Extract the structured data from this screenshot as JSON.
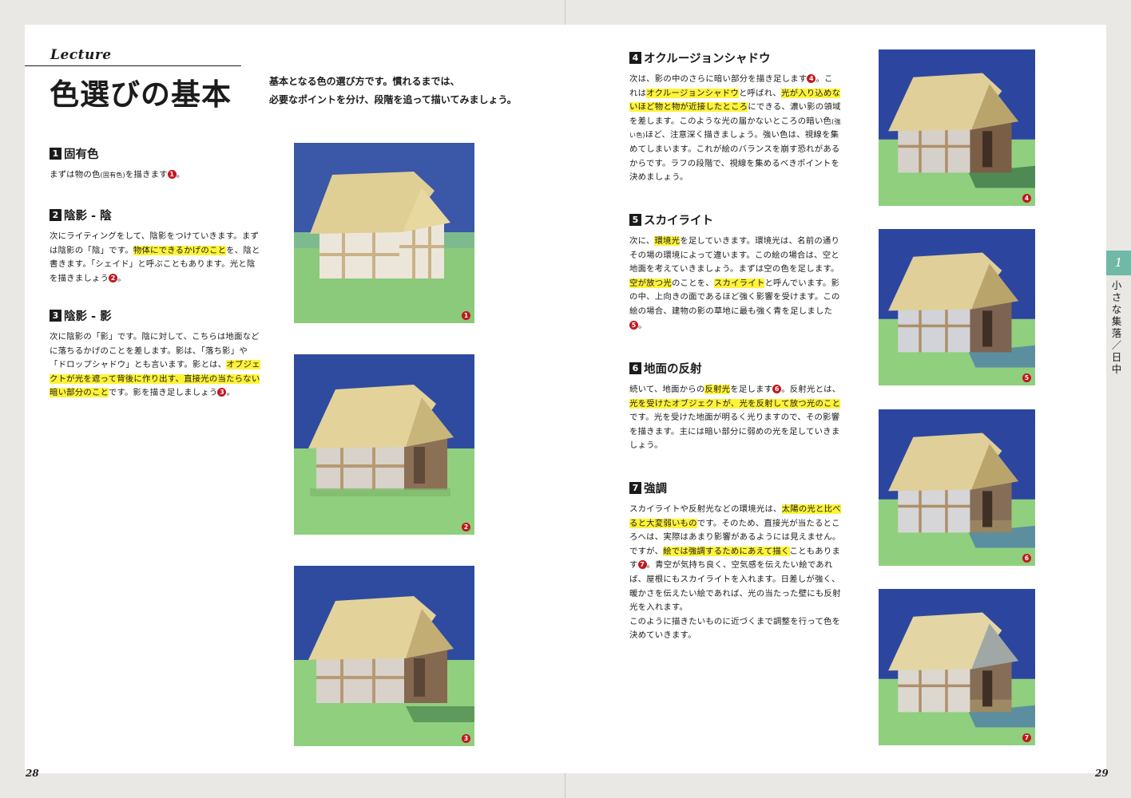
{
  "left_page": {
    "lecture_label": "Lecture",
    "title": "色選びの基本",
    "intro_line1": "基本となる色の選び方です。慣れるまでは、",
    "intro_line2": "必要なポイントを分け、段階を追って描いてみましょう。",
    "folio": "28",
    "sections": [
      {
        "num": "1",
        "heading": "固有色",
        "text_a": "まずは物の色",
        "text_small": "(固有色)",
        "text_b": "を描きます",
        "marker": "1"
      },
      {
        "num": "2",
        "heading": "陰影 - 陰",
        "text_a": "次にライティングをして、陰影をつけていきます。まずは陰影の「陰」です。",
        "highlight": "物体にできるかげのこと",
        "text_b": "を、陰と書きます。「シェイド」と呼ぶこともあります。光と陰を描きましょう",
        "marker": "2"
      },
      {
        "num": "3",
        "heading": "陰影 - 影",
        "text_a": "次に陰影の「影」です。陰に対して、こちらは地面などに落ちるかげのことを差します。影は、「落ち影」や「ドロップシャドウ」とも言います。影とは、",
        "highlight": "オブジェクトが光を遮って背後に作り出す、直接光の当たらない暗い部分のこと",
        "text_b": "です。影を描き足しましょう",
        "marker": "3"
      }
    ],
    "images": [
      {
        "marker": "1"
      },
      {
        "marker": "2"
      },
      {
        "marker": "3"
      }
    ]
  },
  "right_page": {
    "folio": "29",
    "chapter_tab": "1",
    "chapter_label": "小さな集落／日中",
    "sections": [
      {
        "num": "4",
        "heading": "オクルージョンシャドウ",
        "t1": "次は、影の中のさらに暗い部分を描き足します",
        "m1": "4",
        "t2": "。これは",
        "h1": "オクルージョンシャドウ",
        "t3": "と呼ばれ、",
        "h2": "光が入り込めないほど物と物が近接したところ",
        "t4": "にできる、濃い影の領域を差します。このような光の届かないところの暗い色",
        "small": "(強い色)",
        "t5": "ほど、注意深く描きましょう。強い色は、視線を集めてしまいます。これが絵のバランスを崩す恐れがあるからです。ラフの段階で、視線を集めるべきポイントを決めましょう。"
      },
      {
        "num": "5",
        "heading": "スカイライト",
        "t1": "次に、",
        "h1": "環境光",
        "t2": "を足していきます。環境光は、名前の通りその場の環境によって違います。この絵の場合は、空と地面を考えていきましょう。まずは空の色を足します。",
        "h2": "空が放つ光",
        "t3": "のことを、",
        "h3": "スカイライト",
        "t4": "と呼んでいます。影の中、上向きの面であるほど強く影響を受けます。この絵の場合、建物の影の草地に最も強く青を足しました",
        "m1": "5",
        "t5": "。"
      },
      {
        "num": "6",
        "heading": "地面の反射",
        "t1": "続いて、地面からの",
        "h1": "反射光",
        "t2": "を足します",
        "m1": "6",
        "t3": "。反射光とは、",
        "h2": "光を受けたオブジェクトが、光を反射して放つ光のこと",
        "t4": "です。光を受けた地面が明るく光りますので、その影響を描きます。主には暗い部分に弱めの光を足していきましょう。"
      },
      {
        "num": "7",
        "heading": "強調",
        "t1": "スカイライトや反射光などの環境光は、",
        "h1": "太陽の光と比べると大変弱いもの",
        "t2": "です。そのため、直接光が当たるところへは、実際はあまり影響があるようには見えません。",
        "t3": "ですが、",
        "h2": "絵では強調するためにあえて描く",
        "t4": "こともあります",
        "m1": "7",
        "t5": "。青空が気持ち良く、空気感を伝えたい絵であれば、屋根にもスカイライトを入れます。日差しが強く、暖かさを伝えたい絵であれば、光の当たった壁にも反射光を入れます。",
        "t6": "このように描きたいものに近づくまで調整を行って色を決めていきます。"
      }
    ],
    "images": [
      {
        "marker": "4"
      },
      {
        "marker": "5"
      },
      {
        "marker": "6"
      },
      {
        "marker": "7"
      }
    ]
  }
}
